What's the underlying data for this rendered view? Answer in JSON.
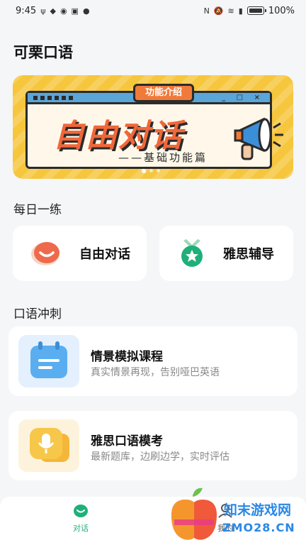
{
  "status_bar": {
    "time": "9:45",
    "battery": "100%"
  },
  "app": {
    "title": "可栗口语"
  },
  "banner": {
    "tag": "功能介绍",
    "headline": "自由对话",
    "subtitle": "——基础功能篇",
    "window_controls": "_ □ ×",
    "page_count": 3,
    "active_page": 1
  },
  "daily": {
    "title": "每日一练",
    "items": [
      {
        "label": "自由对话",
        "icon": "smile-chat-icon"
      },
      {
        "label": "雅思辅导",
        "icon": "star-medal-icon"
      }
    ]
  },
  "sprint": {
    "title": "口语冲刺",
    "courses": [
      {
        "title": "情景模拟课程",
        "desc": "真实情景再现，告别哑巴英语",
        "icon": "calendar-icon"
      },
      {
        "title": "雅思口语模考",
        "desc": "最新题库，边刷边学，实时评估",
        "icon": "microphone-chat-icon"
      }
    ]
  },
  "bottom_nav": {
    "items": [
      {
        "label": "对话",
        "active": true
      },
      {
        "label": "我的",
        "active": false
      }
    ]
  },
  "watermark": {
    "line1": "知末游戏网",
    "line2": "ZMO28.CN"
  },
  "colors": {
    "accent_green": "#1fb07a",
    "banner_yellow": "#f6c63d",
    "headline_orange": "#f0673a",
    "watermark_blue": "#2a88e6"
  }
}
